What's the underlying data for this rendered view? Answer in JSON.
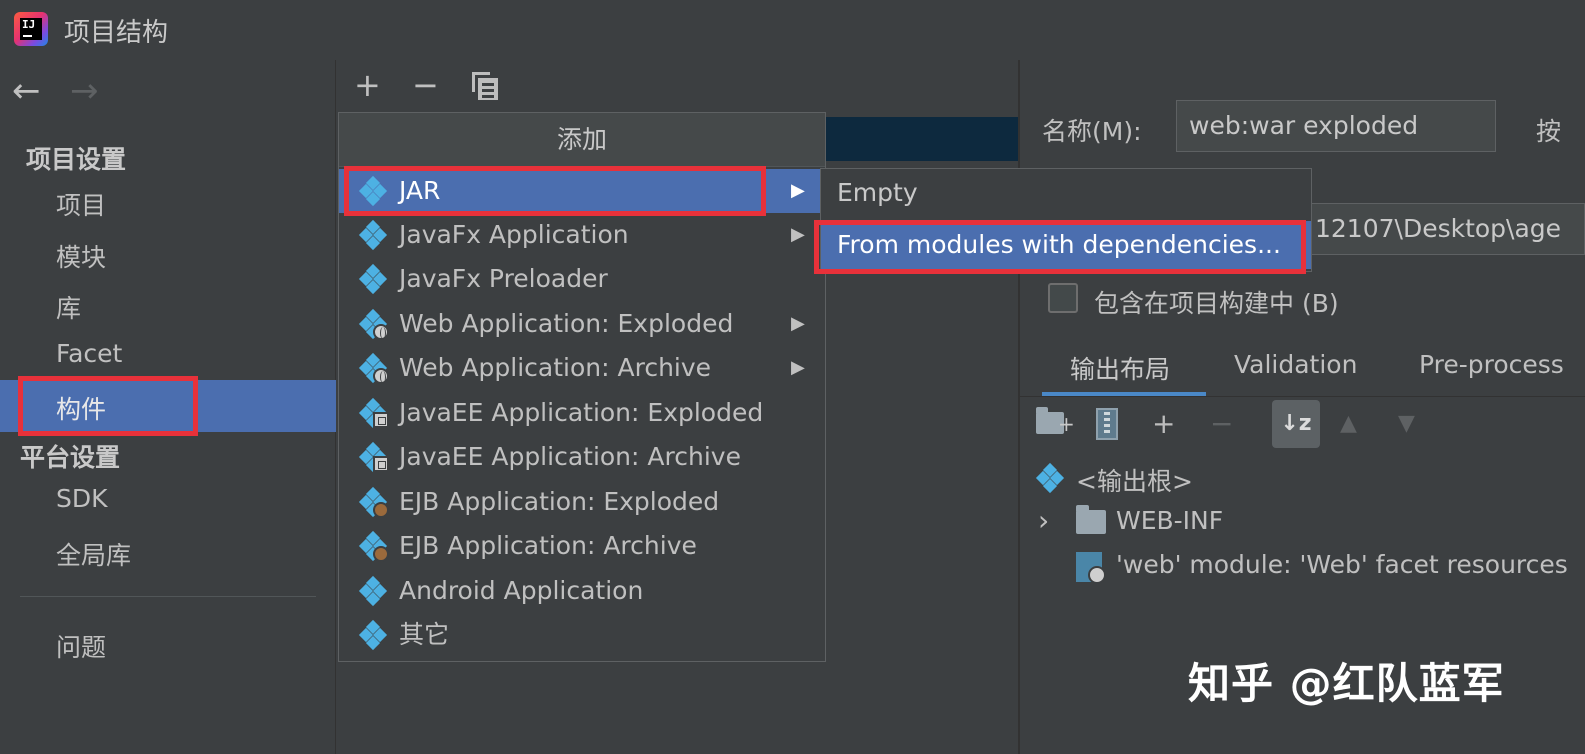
{
  "window": {
    "title": "项目结构"
  },
  "nav": {
    "back": "←",
    "forward": "→"
  },
  "sidebar": {
    "section_project": "项目设置",
    "items_project": [
      "项目",
      "模块",
      "库",
      "Facet",
      "构件"
    ],
    "section_platform": "平台设置",
    "items_platform": [
      "SDK",
      "全局库"
    ],
    "problems": "问题"
  },
  "toolbar": {
    "add": "+",
    "remove": "−"
  },
  "popup": {
    "header": "添加",
    "items": [
      {
        "label": "JAR",
        "icon": "artifact-icon",
        "submenu": true,
        "highlighted": true
      },
      {
        "label": "JavaFx Application",
        "icon": "artifact-icon",
        "submenu": true
      },
      {
        "label": "JavaFx Preloader",
        "icon": "artifact-icon",
        "submenu": false
      },
      {
        "label": "Web Application: Exploded",
        "icon": "web-artifact-icon",
        "submenu": true
      },
      {
        "label": "Web Application: Archive",
        "icon": "web-artifact-icon",
        "submenu": true
      },
      {
        "label": "JavaEE Application: Exploded",
        "icon": "javaee-artifact-icon",
        "submenu": false
      },
      {
        "label": "JavaEE Application: Archive",
        "icon": "javaee-artifact-icon",
        "submenu": false
      },
      {
        "label": "EJB Application: Exploded",
        "icon": "ejb-artifact-icon",
        "submenu": false
      },
      {
        "label": "EJB Application: Archive",
        "icon": "ejb-artifact-icon",
        "submenu": false
      },
      {
        "label": "Android Application",
        "icon": "artifact-icon",
        "submenu": false
      },
      {
        "label": "其它",
        "icon": "artifact-icon",
        "submenu": false
      }
    ],
    "arrow": "▶"
  },
  "submenu": {
    "items": [
      "Empty",
      "From modules with dependencies..."
    ]
  },
  "details": {
    "name_label": "名称(M):",
    "name_value": "web:war exploded",
    "type_label_partial": "按",
    "output_path_partial": "12107\\Desktop\\age",
    "include_in_build": "包含在项目构建中 (B)",
    "include_checked": false,
    "tabs": [
      "输出布局",
      "Validation",
      "Pre-process"
    ],
    "toolbar": {
      "add": "+",
      "remove": "−",
      "sort": "↓z",
      "up": "▲",
      "down": "▼"
    },
    "tree": {
      "root": "<输出根>",
      "expander": "›",
      "folder": "WEB-INF",
      "resource": "'web' module: 'Web' facet resources"
    }
  },
  "watermark": "知乎 @红队蓝军",
  "colors": {
    "background": "#3c3f41",
    "selection": "#4b6eaf",
    "highlight_outline": "#e8313a",
    "accent_tab": "#4a88c7",
    "icon_blue": "#4db1e3"
  }
}
